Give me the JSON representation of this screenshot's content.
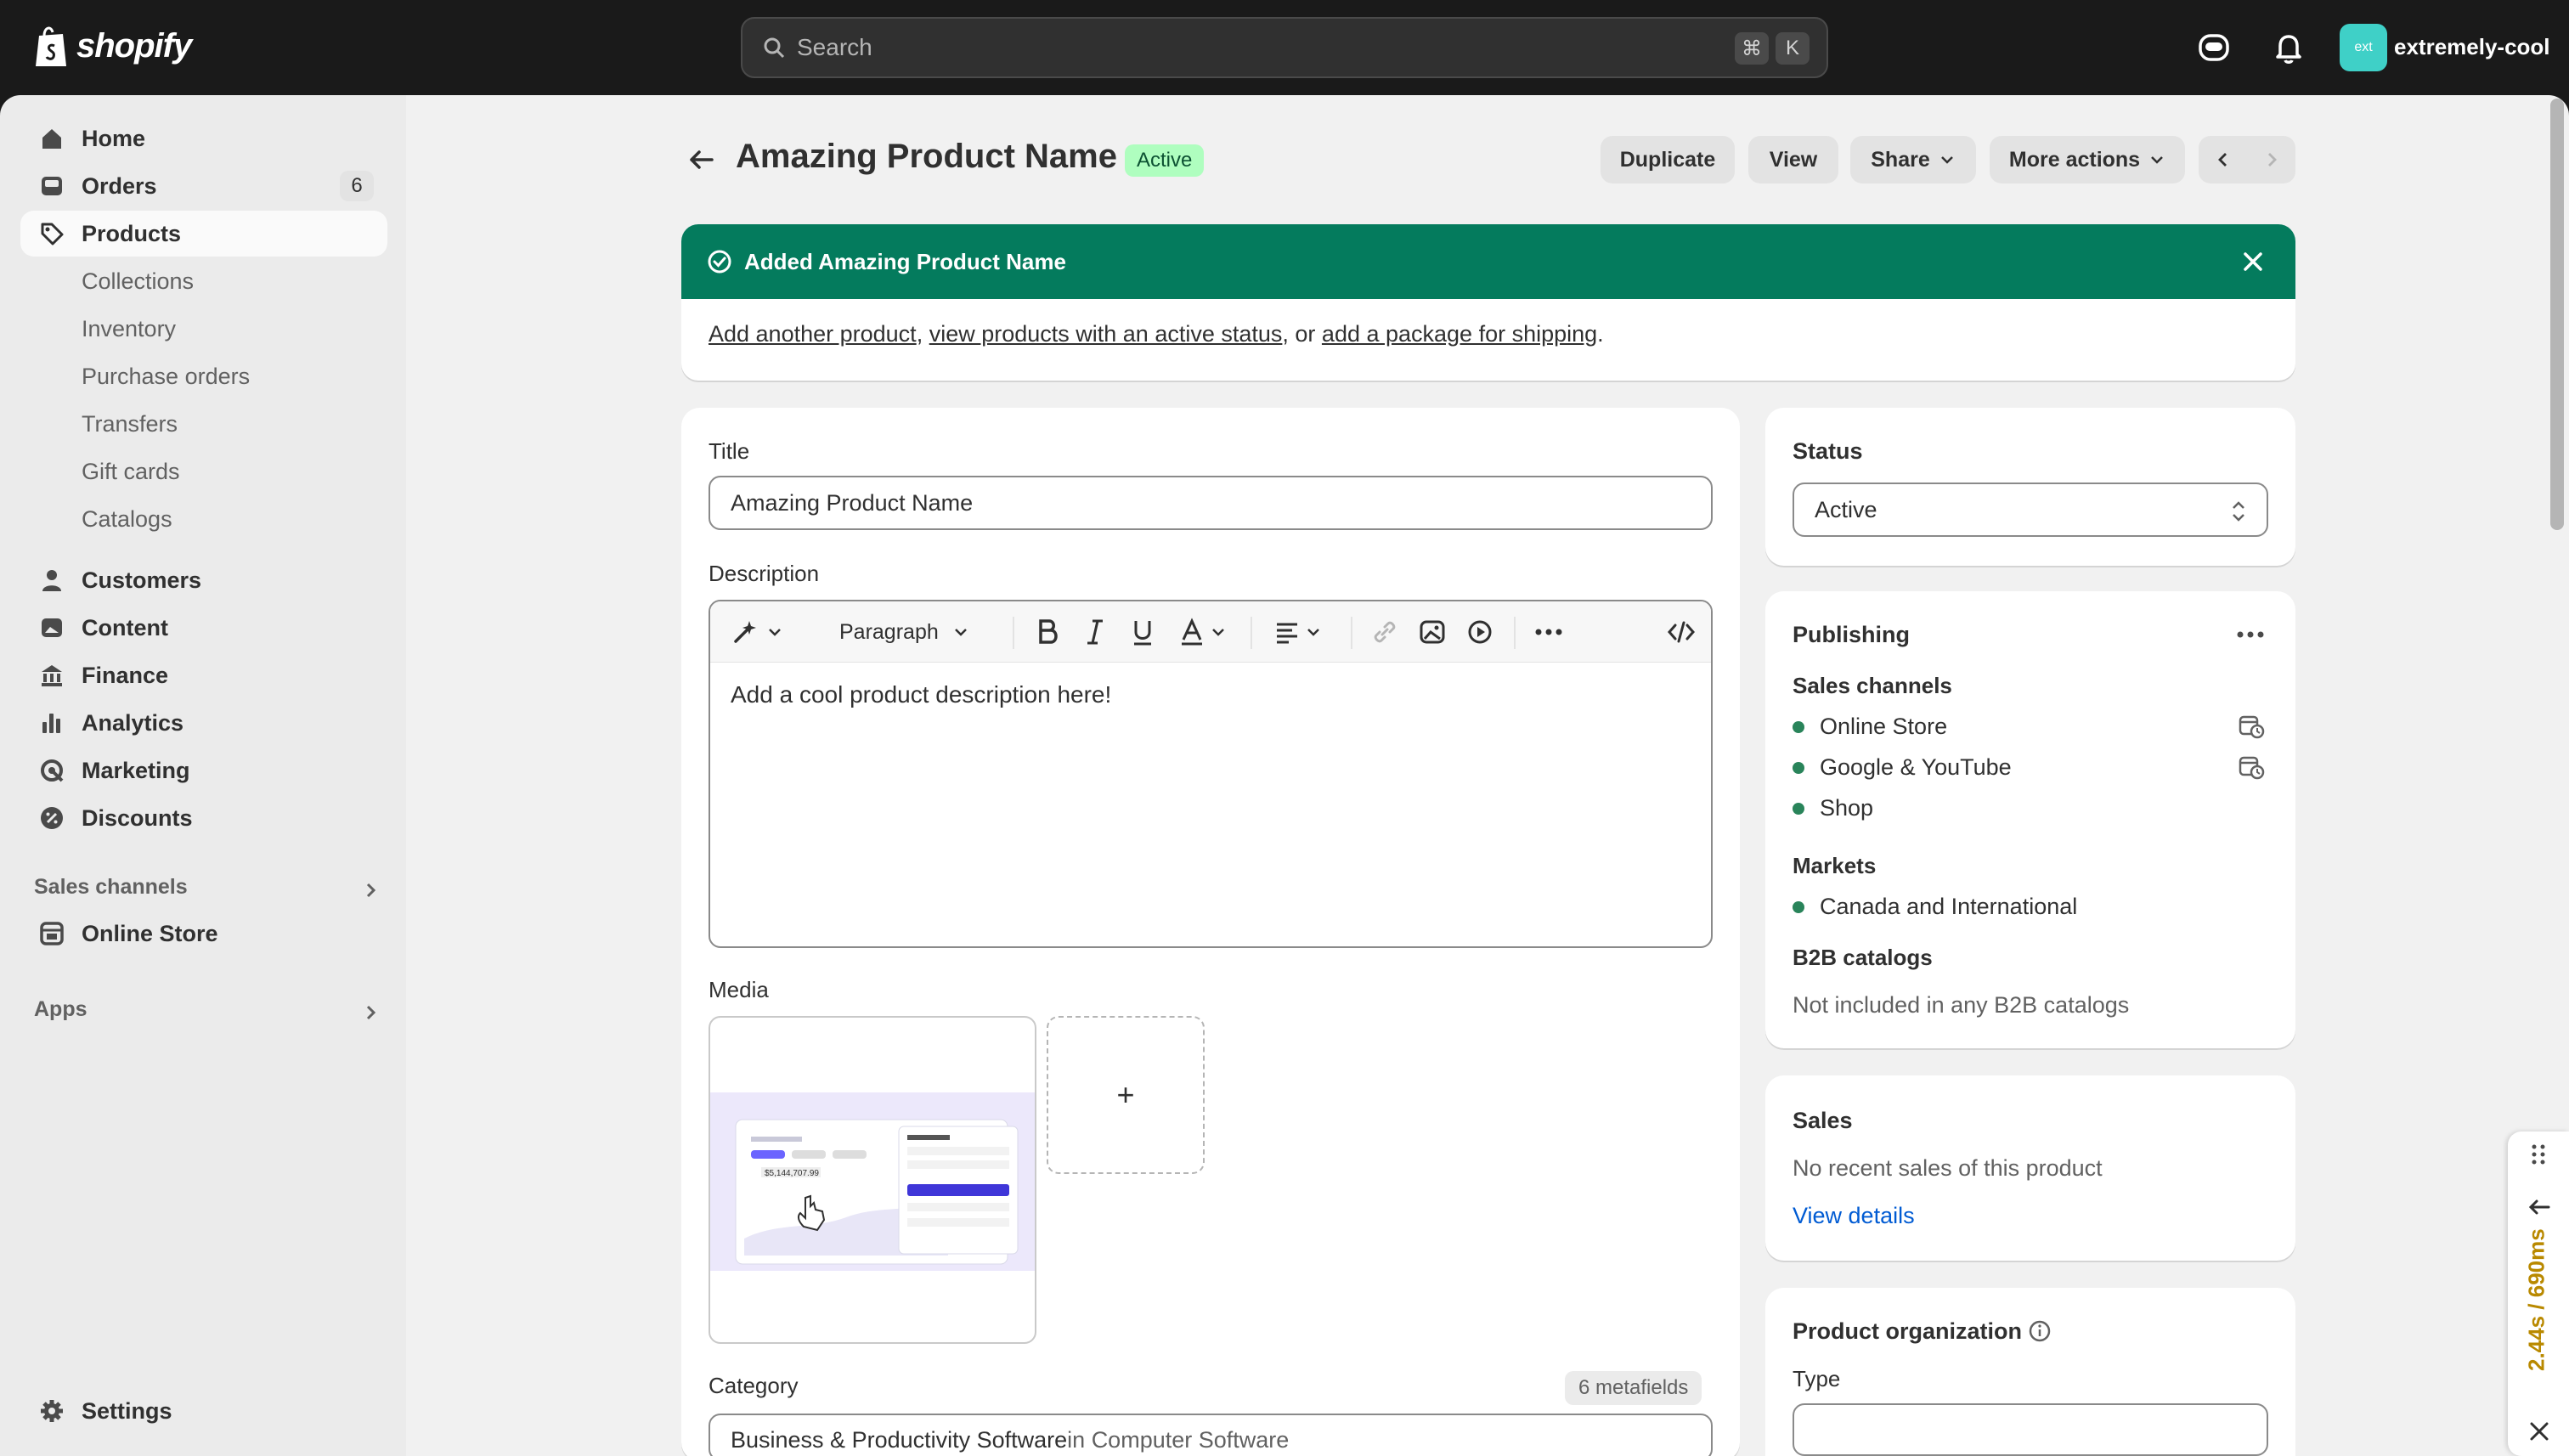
{
  "topbar": {
    "brand": "shopify",
    "search_placeholder": "Search",
    "shortcut_keys": [
      "⌘",
      "K"
    ],
    "store_avatar_initials": "ext",
    "store_name": "extremely-cool",
    "store_avatar_color": "#3fd0c7"
  },
  "sidebar": {
    "items": [
      {
        "label": "Home",
        "icon": "home-icon"
      },
      {
        "label": "Orders",
        "icon": "inbox-icon",
        "count": "6"
      },
      {
        "label": "Products",
        "icon": "tag-icon",
        "selected": true
      },
      {
        "label": "Customers",
        "icon": "person-icon"
      },
      {
        "label": "Content",
        "icon": "image-icon"
      },
      {
        "label": "Finance",
        "icon": "bank-icon"
      },
      {
        "label": "Analytics",
        "icon": "bar-chart-icon"
      },
      {
        "label": "Marketing",
        "icon": "target-icon"
      },
      {
        "label": "Discounts",
        "icon": "discount-icon"
      }
    ],
    "product_subitems": [
      "Collections",
      "Inventory",
      "Purchase orders",
      "Transfers",
      "Gift cards",
      "Catalogs"
    ],
    "sales_channels_heading": "Sales channels",
    "sales_channels": [
      {
        "label": "Online Store",
        "icon": "store-icon"
      }
    ],
    "apps_heading": "Apps",
    "settings_label": "Settings"
  },
  "header": {
    "title": "Amazing Product Name",
    "status_badge": "Active",
    "buttons": {
      "duplicate": "Duplicate",
      "view": "View",
      "share": "Share",
      "more_actions": "More actions"
    }
  },
  "banner": {
    "title": "Added Amazing Product Name",
    "link_add_another": "Add another product",
    "sep1": ", ",
    "link_view_active": "view products with an active status",
    "sep2": ", or ",
    "link_add_package": "add a package for shipping",
    "end": ".",
    "color": "#047b5d"
  },
  "product": {
    "title_label": "Title",
    "title_value": "Amazing Product Name",
    "description_label": "Description",
    "toolbar_paragraph": "Paragraph",
    "description_value": "Add a cool product description here!",
    "media_label": "Media",
    "media_add": "+",
    "category_label": "Category",
    "metafields": "6 metafields",
    "category_value": "Business & Productivity Software",
    "category_parent": " in Computer Software"
  },
  "status_card": {
    "label": "Status",
    "value": "Active"
  },
  "publishing": {
    "title": "Publishing",
    "sales_channels_heading": "Sales channels",
    "channels": [
      "Online Store",
      "Google & YouTube",
      "Shop"
    ],
    "markets_heading": "Markets",
    "markets": [
      "Canada and International"
    ],
    "b2b_heading": "B2B catalogs",
    "b2b_value": "Not included in any B2B catalogs"
  },
  "sales_card": {
    "title": "Sales",
    "text": "No recent sales of this product",
    "link": "View details"
  },
  "organization": {
    "title": "Product organization",
    "type_label": "Type"
  },
  "timer_widget": {
    "text": "2.44s / 690ms"
  }
}
